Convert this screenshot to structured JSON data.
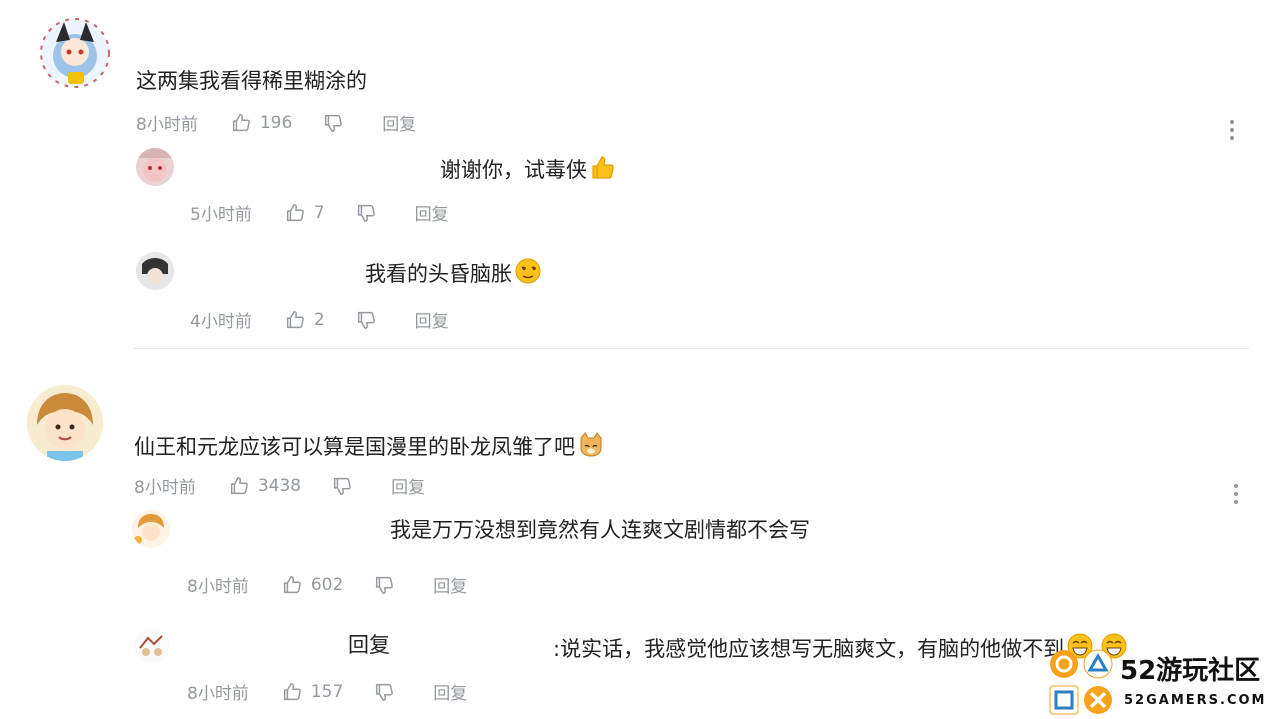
{
  "comments": [
    {
      "text": "这两集我看得稀里糊涂的",
      "time": "8小时前",
      "likes": "196",
      "reply_label": "回复",
      "replies": [
        {
          "text": "谢谢你，试毒侠",
          "time": "5小时前",
          "likes": "7",
          "reply_label": "回复",
          "emoji": "thumbs-up-emoji"
        },
        {
          "text": "我看的头昏脑胀",
          "time": "4小时前",
          "likes": "2",
          "reply_label": "回复",
          "emoji": "dizzy-face-emoji"
        }
      ]
    },
    {
      "text": "仙王和元龙应该可以算是国漫里的卧龙凤雏了吧",
      "time": "8小时前",
      "likes": "3438",
      "reply_label": "回复",
      "emoji": "doge-emoji",
      "replies": [
        {
          "text": "我是万万没想到竟然有人连爽文剧情都不会写",
          "time": "8小时前",
          "likes": "602",
          "reply_label": "回复"
        },
        {
          "prefix": "回复",
          "text": ":说实话，我感觉他应该想写无脑爽文，有脑的他做不到",
          "time": "8小时前",
          "likes": "157",
          "reply_label": "回复",
          "emoji": "laughing-emoji"
        }
      ]
    }
  ],
  "watermark": {
    "brand": "52游玩社区",
    "url": "52GAMERS.COM"
  },
  "colors": {
    "meta": "#9499a0",
    "text": "#222222",
    "divider": "#e3e5e7",
    "watermark_orange": "#f7a21b"
  }
}
